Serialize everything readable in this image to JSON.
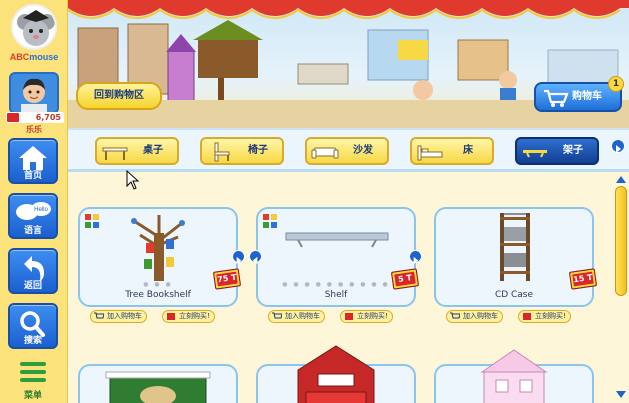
{
  "sidebar": {
    "logo_part1": "ABC",
    "logo_part2": "mouse",
    "points": "6,705",
    "user_name": "乐乐",
    "buttons": [
      {
        "label": "首页",
        "icon": "home-icon"
      },
      {
        "label": "语言",
        "icon": "language-icon",
        "bubble": "Hello"
      },
      {
        "label": "返回",
        "icon": "back-arrow-icon"
      },
      {
        "label": "搜索",
        "icon": "search-icon"
      }
    ],
    "menu_label": "菜单"
  },
  "scene": {
    "back_label": "回到购物区",
    "cart_label": "购物车",
    "cart_count": "1"
  },
  "categories": [
    {
      "label": "桌子",
      "icon": "table-icon",
      "active": false
    },
    {
      "label": "椅子",
      "icon": "chair-icon",
      "active": false
    },
    {
      "label": "沙发",
      "icon": "sofa-icon",
      "active": false
    },
    {
      "label": "床",
      "icon": "bed-icon",
      "active": false
    },
    {
      "label": "架子",
      "icon": "shelf-icon",
      "active": true
    }
  ],
  "products": [
    {
      "name": "Tree Bookshelf",
      "price": "75 T",
      "add_label": "加入购物车",
      "buy_label": "立刻购买!"
    },
    {
      "name": "Shelf",
      "price": "5 T",
      "add_label": "加入购物车",
      "buy_label": "立刻购买!"
    },
    {
      "name": "CD Case",
      "price": "15 T",
      "add_label": "加入购物车",
      "buy_label": "立刻购买!"
    }
  ],
  "colors": {
    "sidebar_bg": "#fbe27a",
    "button_blue": "#1c5fd0",
    "price_red": "#d8262b",
    "tab_yellow": "#f7d845",
    "tab_active": "#123f92"
  }
}
